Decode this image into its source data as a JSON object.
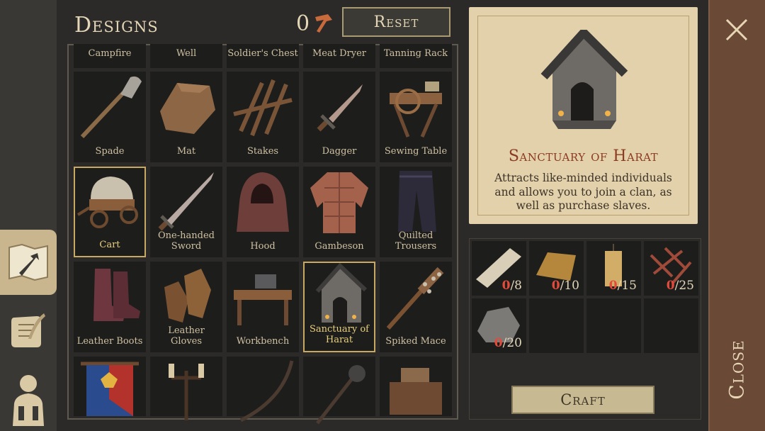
{
  "header": {
    "title": "Designs",
    "resource_count": "0",
    "reset_label": "Reset"
  },
  "sidebar": {
    "tabs": [
      {
        "name": "tab-designs",
        "icon": "hammer-map-icon",
        "active": true
      },
      {
        "name": "tab-recipes",
        "icon": "scroll-quill-icon",
        "active": false
      },
      {
        "name": "tab-character",
        "icon": "character-icon",
        "active": false
      }
    ]
  },
  "grid": {
    "top_row": [
      "Campfire",
      "Well",
      "Soldier's Chest",
      "Meat Dryer",
      "Tanning Rack"
    ],
    "rows": [
      [
        "Spade",
        "Mat",
        "Stakes",
        "Dagger",
        "Sewing Table"
      ],
      [
        "Cart",
        "One-handed Sword",
        "Hood",
        "Gambeson",
        "Quilted Trousers"
      ],
      [
        "Leather Boots",
        "Leather Gloves",
        "Workbench",
        "Sanctuary of Harat",
        "Spiked Mace"
      ],
      [
        "",
        "",
        "",
        "",
        ""
      ]
    ],
    "highlighted": [
      "Cart",
      "Sanctuary of Harat"
    ]
  },
  "detail": {
    "title": "Sanctuary of Harat",
    "description": "Attracts like-minded individuals and allows you to join a clan, as well as purchase slaves."
  },
  "resources": [
    {
      "icon": "plank-icon",
      "have": "0",
      "need": "/8"
    },
    {
      "icon": "ingot-icon",
      "have": "0",
      "need": "/10"
    },
    {
      "icon": "candle-icon",
      "have": "0",
      "need": "/15"
    },
    {
      "icon": "nails-icon",
      "have": "0",
      "need": "/25"
    },
    {
      "icon": "stone-icon",
      "have": "0",
      "need": "/20"
    }
  ],
  "craft_label": "Craft",
  "close_label": "Close"
}
